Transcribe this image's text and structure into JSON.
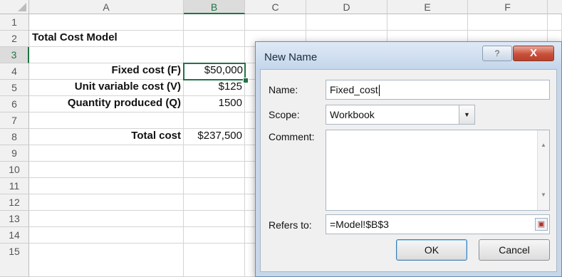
{
  "spreadsheet": {
    "columns": [
      "A",
      "B",
      "C",
      "D",
      "E",
      "F"
    ],
    "rows": [
      "1",
      "2",
      "3",
      "4",
      "5",
      "6",
      "7",
      "8",
      "9",
      "10",
      "11",
      "12",
      "13",
      "14",
      "15"
    ],
    "cells": {
      "A1": "Total Cost Model",
      "A3": "Fixed cost (F)",
      "B3": "$50,000",
      "A4": "Unit variable cost (V)",
      "B4": "$125",
      "A5": "Quantity produced (Q)",
      "B5": "1500",
      "A7": "Total  cost",
      "B7": "$237,500"
    },
    "active_cell": "B3"
  },
  "dialog": {
    "title": "New Name",
    "help_glyph": "?",
    "close_glyph": "X",
    "name_label": "Name:",
    "name_value": "Fixed_cost",
    "scope_label": "Scope:",
    "scope_value": "Workbook",
    "comment_label": "Comment:",
    "comment_value": "",
    "refers_label": "Refers to:",
    "refers_value": "=Model!$B$3",
    "ok_label": "OK",
    "cancel_label": "Cancel"
  },
  "colors": {
    "accent": "#217346",
    "dialog_frame": "#c7d7ea",
    "close_button": "#c9503a"
  },
  "icons": [
    "help-icon",
    "close-icon",
    "dropdown-arrow-icon",
    "scroll-up-icon",
    "scroll-down-icon",
    "collapse-dialog-icon"
  ]
}
